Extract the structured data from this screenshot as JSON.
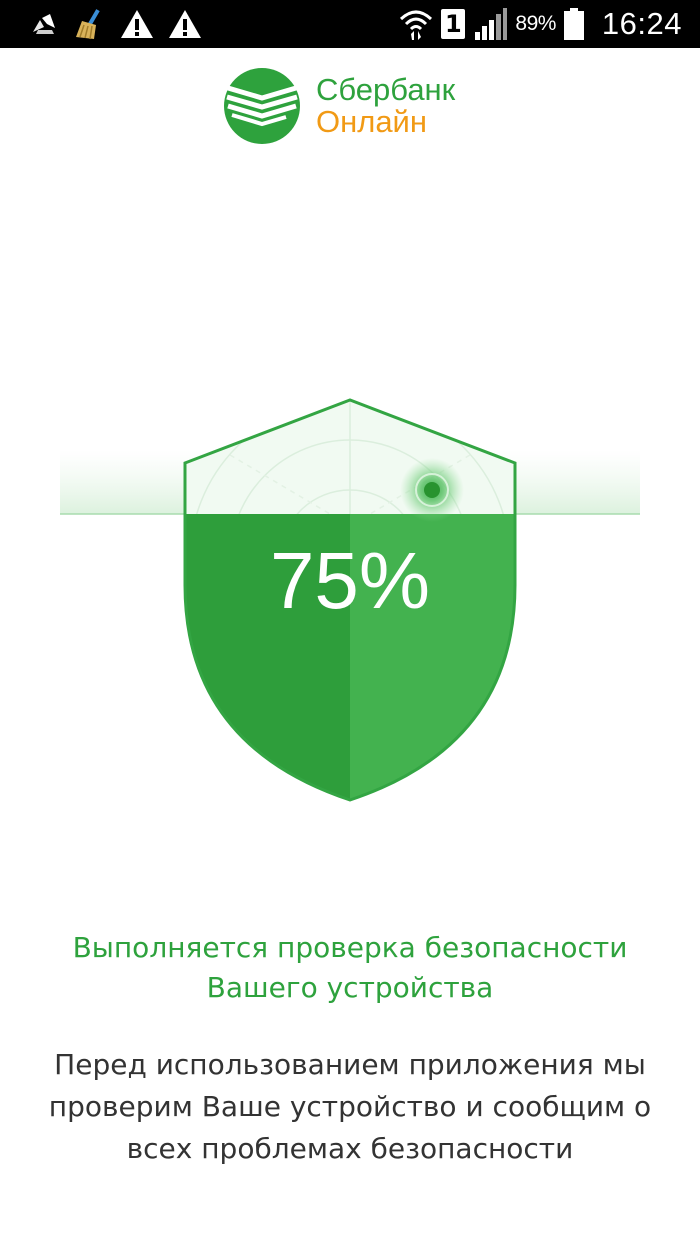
{
  "status_bar": {
    "left_icons": [
      "recycle-icon",
      "broom-icon",
      "warning-icon",
      "warning-icon"
    ],
    "sim_slot": "1",
    "battery_percent": "89%",
    "time": "16:24"
  },
  "logo": {
    "line1": "Сбербанк",
    "line2": "Онлайн",
    "brand_green": "#2ea23d",
    "brand_orange": "#f19a15"
  },
  "security_check": {
    "progress": 75,
    "progress_label": "75%"
  },
  "messages": {
    "status_line1": "Выполняется проверка безопасности",
    "status_line2": "Вашего устройства",
    "desc_line1": "Перед использованием приложения мы",
    "desc_line2": "проверим Ваше устройство и сообщим о",
    "desc_line3": "всех проблемах безопасности"
  }
}
